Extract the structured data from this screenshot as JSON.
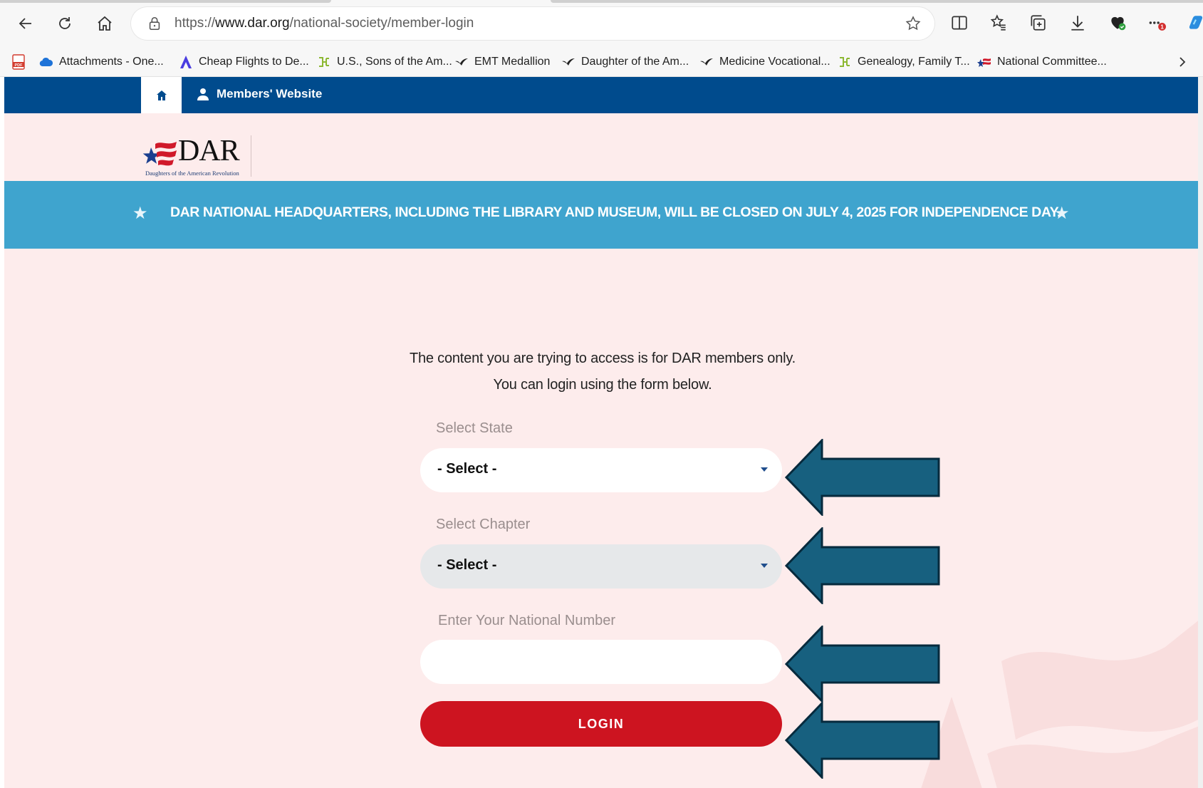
{
  "browser": {
    "url_prefix": "https://",
    "url_host": "www.dar.org",
    "url_path": "/national-society/member-login",
    "icons": [
      "back-icon",
      "refresh-icon",
      "home-icon",
      "lock-icon",
      "star-icon",
      "split-screen-icon",
      "favorites-icon",
      "collections-icon",
      "download-icon",
      "health-icon",
      "more-icon",
      "copilot-icon"
    ],
    "notification_count": "1"
  },
  "bookmarks": [
    {
      "label": "Attachments - One...",
      "icon": "cloud-icon"
    },
    {
      "label": "Cheap Flights to De...",
      "icon": "flight-icon"
    },
    {
      "label": "U.S., Sons of the Am...",
      "icon": "ancestry-icon"
    },
    {
      "label": "EMT Medallion",
      "icon": "bird-icon"
    },
    {
      "label": "Daughter of the Am...",
      "icon": "bird-icon"
    },
    {
      "label": "Medicine Vocational...",
      "icon": "bird-icon"
    },
    {
      "label": "Genealogy, Family T...",
      "icon": "ancestry-icon"
    },
    {
      "label": "National Committee...",
      "icon": "dar-flag-icon"
    }
  ],
  "site": {
    "nav": {
      "members_label": "Members' Website"
    },
    "logo": {
      "text": "DAR",
      "subtext": "Daughters of the American Revolution"
    },
    "banner": "DAR NATIONAL HEADQUARTERS, INCLUDING THE LIBRARY AND MUSEUM, WILL BE CLOSED ON JULY 4, 2025 FOR INDEPENDENCE DAY.",
    "intro_line1": "The content you are trying to access is for DAR members only.",
    "intro_line2": "You can login using the form below.",
    "form": {
      "state_label": "Select State",
      "state_value": "- Select -",
      "chapter_label": "Select Chapter",
      "chapter_value": "- Select -",
      "national_number_label": "Enter Your National Number",
      "national_number_value": "",
      "login_label": "LOGIN"
    }
  },
  "colors": {
    "nav_blue": "#004b8d",
    "banner_blue": "#3fa4ce",
    "page_bg": "#fdecec",
    "login_red": "#cd1420",
    "annotation_arrow": "#17607f"
  }
}
